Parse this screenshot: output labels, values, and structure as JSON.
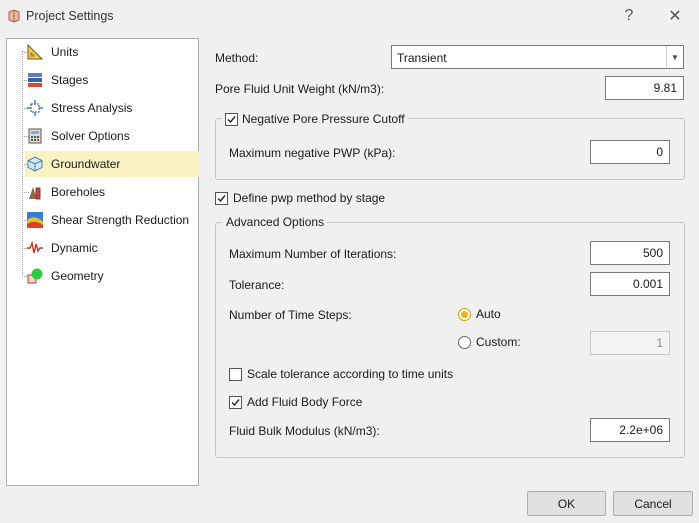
{
  "window": {
    "title": "Project Settings",
    "help_label": "?",
    "close_label": "✕"
  },
  "sidebar": {
    "items": [
      {
        "label": "Units",
        "icon": "units-icon"
      },
      {
        "label": "Stages",
        "icon": "stages-icon"
      },
      {
        "label": "Stress Analysis",
        "icon": "stress-analysis-icon"
      },
      {
        "label": "Solver Options",
        "icon": "solver-options-icon"
      },
      {
        "label": "Groundwater",
        "icon": "groundwater-icon",
        "selected": true
      },
      {
        "label": "Boreholes",
        "icon": "boreholes-icon"
      },
      {
        "label": "Shear Strength Reduction",
        "icon": "shear-strength-icon"
      },
      {
        "label": "Dynamic",
        "icon": "dynamic-icon"
      },
      {
        "label": "Geometry",
        "icon": "geometry-icon"
      }
    ]
  },
  "form": {
    "method_label": "Method:",
    "method_value": "Transient",
    "unit_weight_label": "Pore Fluid Unit Weight (kN/m3):",
    "unit_weight_value": "9.81",
    "neg_cutoff_label": "Negative Pore Pressure Cutoff",
    "neg_cutoff_checked": true,
    "max_neg_pwp_label": "Maximum negative PWP (kPa):",
    "max_neg_pwp_value": "0",
    "define_by_stage_label": "Define pwp method by stage",
    "define_by_stage_checked": true,
    "advanced_label": "Advanced Options",
    "max_iter_label": "Maximum Number of Iterations:",
    "max_iter_value": "500",
    "tolerance_label": "Tolerance:",
    "tolerance_value": "0.001",
    "time_steps_label": "Number of Time Steps:",
    "auto_label": "Auto",
    "custom_label": "Custom:",
    "custom_value": "1",
    "selected_time_steps": "Auto",
    "scale_tol_label": "Scale tolerance according to time units",
    "scale_tol_checked": false,
    "body_force_label": "Add Fluid Body Force",
    "body_force_checked": true,
    "bulk_modulus_label": "Fluid Bulk Modulus (kN/m3):",
    "bulk_modulus_value": "2.2e+06"
  },
  "buttons": {
    "ok": "OK",
    "cancel": "Cancel"
  },
  "colors": {
    "selection_bg": "#fbf2c4",
    "radio_accent": "#f2b316"
  }
}
